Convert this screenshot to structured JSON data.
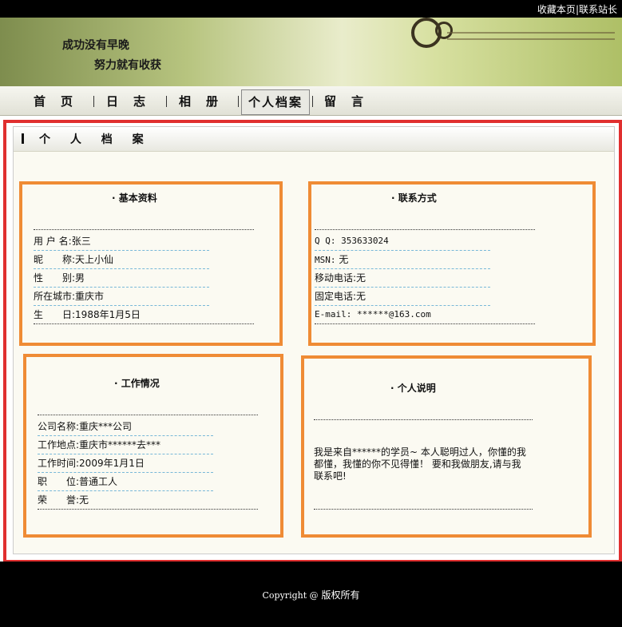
{
  "topbar": {
    "bookmark": "收藏本页",
    "separator": "|",
    "contact": "联系站长"
  },
  "banner": {
    "line1": "成功没有早晚",
    "line2": "努力就有收获"
  },
  "nav": {
    "items": [
      "首　页",
      "日　志",
      "相　册",
      "个人档案",
      "留　言"
    ],
    "active": "个人档案"
  },
  "panel": {
    "title": "个 人 档 案"
  },
  "basic": {
    "title": "· 基本资料",
    "rows": [
      {
        "label": "用 户 名:",
        "value": "张三"
      },
      {
        "label": "昵　　称:",
        "value": "天上小仙"
      },
      {
        "label": "性　　别:",
        "value": "男"
      },
      {
        "label": "所在城市:",
        "value": "重庆市"
      },
      {
        "label": "生　　日:",
        "value": "1988年1月5日"
      }
    ]
  },
  "contact": {
    "title": "· 联系方式",
    "rows": [
      {
        "label": "Q Q:",
        "value": "353633024"
      },
      {
        "label": "MSN:",
        "value": "无"
      },
      {
        "label": "移动电话:",
        "value": "无"
      },
      {
        "label": "固定电话:",
        "value": "无"
      },
      {
        "label": "E-mail:",
        "value": "******@163.com"
      }
    ]
  },
  "work": {
    "title": "· 工作情况",
    "rows": [
      {
        "label": "公司名称:",
        "value": "重庆***公司"
      },
      {
        "label": "工作地点:",
        "value": "重庆市******去***"
      },
      {
        "label": "工作时间:",
        "value": "2009年1月1日"
      },
      {
        "label": "职　　位:",
        "value": "普通工人"
      },
      {
        "label": "荣　　誉:",
        "value": "无"
      }
    ]
  },
  "about": {
    "title": "· 个人说明",
    "text": "我是来自******的学员~ 本人聪明过人，你懂的我都懂，我懂的你不见得懂！ 要和我做朋友,请与我联系吧!"
  },
  "footer": {
    "copyright_en": "Copyright @",
    "copyright_cn": " 版权所有"
  }
}
